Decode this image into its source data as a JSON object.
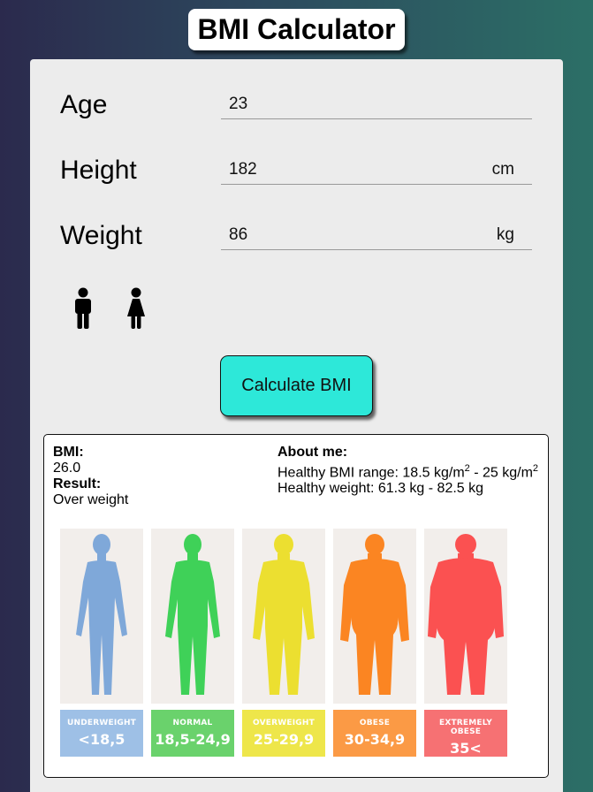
{
  "app": {
    "title": "BMI Calculator"
  },
  "form": {
    "age": {
      "label": "Age",
      "value": "23"
    },
    "height": {
      "label": "Height",
      "value": "182",
      "unit": "cm"
    },
    "weight": {
      "label": "Weight",
      "value": "86",
      "unit": "kg"
    },
    "gender_icons": [
      "male-icon",
      "female-icon"
    ],
    "calculate_label": "Calculate BMI"
  },
  "result": {
    "bmi_label": "BMI:",
    "bmi_value": "26.0",
    "result_label": "Result:",
    "result_value": "Over weight",
    "about_label": "About me:",
    "range_text": "Healthy BMI range: 18.5 kg/m",
    "range_sup1": "2",
    "range_mid": " - 25 kg/m",
    "range_sup2": "2",
    "weight_text": "Healthy weight: 61.3 kg - 82.5 kg"
  },
  "categories": [
    {
      "name": "UNDERWEIGHT",
      "range": "<18,5",
      "body_color": "#7fa8d9",
      "tag_color": "#9ec0e6"
    },
    {
      "name": "NORMAL",
      "range": "18,5-24,9",
      "body_color": "#3fd158",
      "tag_color": "#6ad26c"
    },
    {
      "name": "OVERWEIGHT",
      "range": "25-29,9",
      "body_color": "#ecdf30",
      "tag_color": "#eee64a"
    },
    {
      "name": "OBESE",
      "range": "30-34,9",
      "body_color": "#fb8522",
      "tag_color": "#fb9a45"
    },
    {
      "name": "EXTREMELY OBESE",
      "range": "35<",
      "body_color": "#fb5151",
      "tag_color": "#f67173"
    }
  ]
}
